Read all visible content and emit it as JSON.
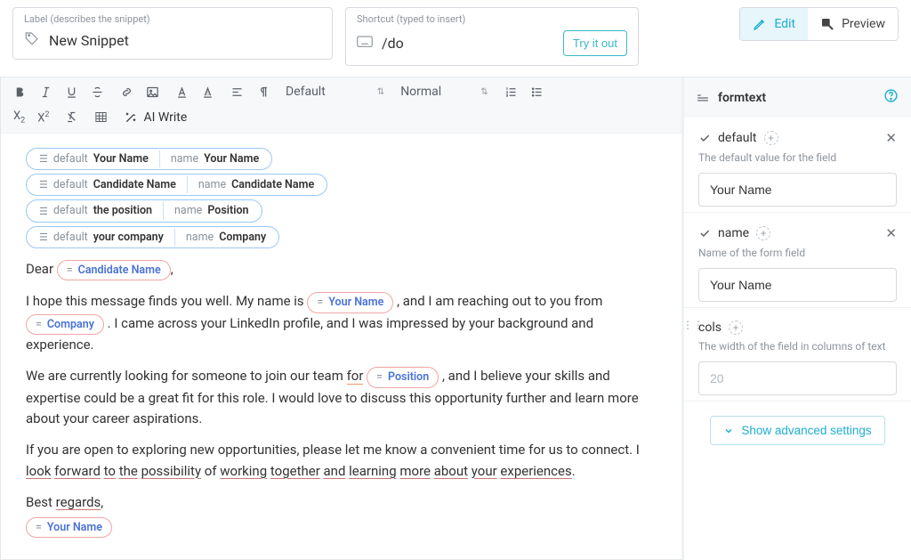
{
  "top": {
    "labelCaption": "Label (describes the snippet)",
    "labelValue": "New Snippet",
    "shortcutCaption": "Shortcut (typed to insert)",
    "shortcutValue": "/do",
    "tryOut": "Try it out",
    "edit": "Edit",
    "preview": "Preview"
  },
  "toolbar": {
    "font": "Default",
    "size": "Normal",
    "aiWrite": "AI Write"
  },
  "formPills": [
    {
      "defaultK": "default",
      "defaultV": "Your Name",
      "nameK": "name",
      "nameV": "Your Name"
    },
    {
      "defaultK": "default",
      "defaultV": "Candidate Name",
      "nameK": "name",
      "nameV": "Candidate Name"
    },
    {
      "defaultK": "default",
      "defaultV": "the position",
      "nameK": "name",
      "nameV": "Position"
    },
    {
      "defaultK": "default",
      "defaultV": "your company",
      "nameK": "name",
      "nameV": "Company"
    }
  ],
  "body": {
    "dear": "Dear ",
    "ref_candidate": "Candidate Name",
    "p1a": "I hope this message finds you well. My name is ",
    "ref_yourname": "Your Name",
    "p1b": ", and I am reaching out to you from ",
    "ref_company": "Company",
    "p1c": ". I came across your LinkedIn profile, and I was impressed by your background and experience.",
    "p2a": "We are currently looking for someone to join our team ",
    "p2_for": "for",
    "ref_position": "Position",
    "p2b": ", and I believe your skills and expertise could be a great fit for this role. I would love to discuss this opportunity further and learn more about your career aspirations.",
    "p3a": "If you are open to exploring new opportunities, please let me know a convenient time for us to connect. I ",
    "p3_look": "look",
    "p3_sp1": " ",
    "p3_forward": "forward",
    "p3_sp2": " ",
    "p3_to": "to",
    "p3_sp3": " ",
    "p3_the": "the",
    "p3_sp4": " ",
    "p3_possibility": "possibility",
    "p3_of": " of ",
    "p3_working": "working",
    "p3_sp5": " ",
    "p3_together": "together",
    "p3_sp6": " ",
    "p3_and": "and",
    "p3_sp7": " ",
    "p3_learning": "learning",
    "p3_sp8": " ",
    "p3_more": "more",
    "p3_sp9": " ",
    "p3_about": "about",
    "p3_sp10": " ",
    "p3_your": "your",
    "p3_sp11": " ",
    "p3_experiences": "experiences",
    "p3_period": ".",
    "best": "Best ",
    "regards": "regards",
    "comma": ","
  },
  "sidebar": {
    "title": "formtext",
    "fields": [
      {
        "name": "default",
        "desc": "The default value for the field",
        "value": "Your Name",
        "hasClear": true
      },
      {
        "name": "name",
        "desc": "Name of the form field",
        "value": "Your Name",
        "hasClear": true
      },
      {
        "name": "cols",
        "desc": "The width of the field in columns of text",
        "placeholder": "20",
        "hasClear": false
      }
    ],
    "advanced": "Show advanced settings"
  }
}
